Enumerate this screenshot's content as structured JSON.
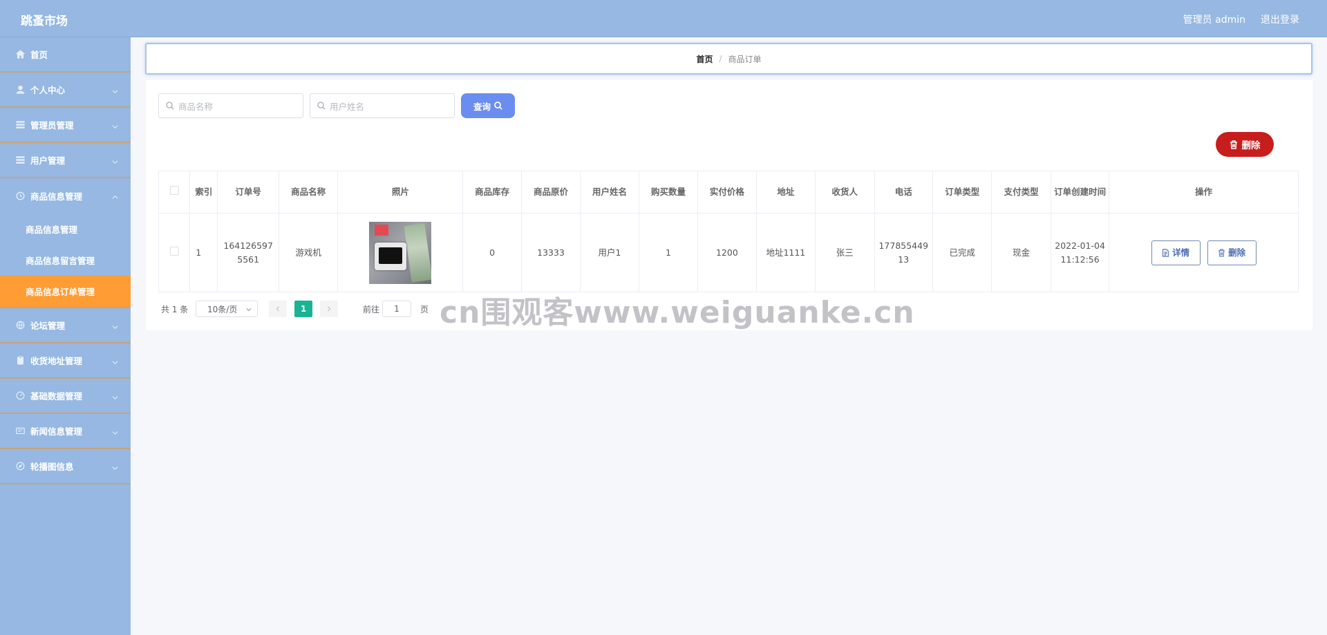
{
  "header": {
    "brand": "跳蚤市场",
    "admin_label": "管理员 admin",
    "logout_label": "退出登录"
  },
  "sidebar": {
    "items": [
      {
        "label": "首页",
        "icon": "home-icon"
      },
      {
        "label": "个人中心",
        "icon": "user-icon"
      },
      {
        "label": "管理员管理",
        "icon": "list-icon"
      },
      {
        "label": "用户管理",
        "icon": "list-icon"
      },
      {
        "label": "商品信息管理",
        "icon": "clock-icon"
      },
      {
        "label": "论坛管理",
        "icon": "globe-icon"
      },
      {
        "label": "收货地址管理",
        "icon": "clipboard-icon"
      },
      {
        "label": "基础数据管理",
        "icon": "dashboard-icon"
      },
      {
        "label": "新闻信息管理",
        "icon": "news-icon"
      },
      {
        "label": "轮播图信息",
        "icon": "compass-icon"
      }
    ],
    "sub_items": [
      {
        "label": "商品信息管理"
      },
      {
        "label": "商品信息留言管理"
      },
      {
        "label": "商品信息订单管理"
      }
    ]
  },
  "breadcrumb": {
    "home": "首页",
    "separator": "/",
    "current": "商品订单"
  },
  "search": {
    "product_placeholder": "商品名称",
    "user_placeholder": "用户姓名",
    "query_label": "查询"
  },
  "toolbar": {
    "delete_label": "删除"
  },
  "table": {
    "headers": [
      "索引",
      "订单号",
      "商品名称",
      "照片",
      "商品库存",
      "商品原价",
      "用户姓名",
      "购买数量",
      "实付价格",
      "地址",
      "收货人",
      "电话",
      "订单类型",
      "支付类型",
      "订单创建时间",
      "操作"
    ],
    "rows": [
      {
        "index": "1",
        "order_no": "1641265975561",
        "product_name": "游戏机",
        "stock": "0",
        "original_price": "13333",
        "user_name": "用户1",
        "quantity": "1",
        "paid_price": "1200",
        "address": "地址1111",
        "receiver": "张三",
        "phone": "17785544913",
        "order_type": "已完成",
        "pay_type": "现金",
        "created_at": "2022-01-04 11:12:56",
        "detail_label": "详情",
        "delete_label": "删除"
      }
    ]
  },
  "pagination": {
    "total": "共 1 条",
    "page_size": "10条/页",
    "current_page": "1",
    "goto_label": "前往",
    "goto_value": "1",
    "page_suffix": "页"
  },
  "watermark": "cn围观客www.weiguanke.cn",
  "colors": {
    "sidebar_bg": "#96b8e2",
    "active_item": "#ff9c33",
    "query_button": "#6b8df0",
    "delete_button": "#c71d1d",
    "current_page": "#1ab394"
  }
}
